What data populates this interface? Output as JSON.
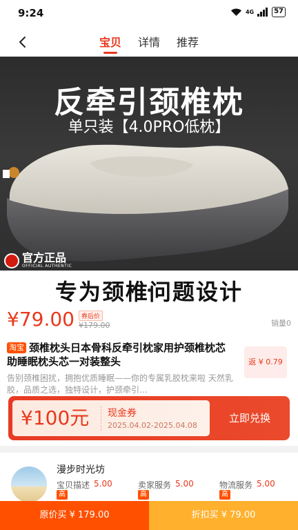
{
  "status_bar": {
    "time": "9:24",
    "network": "4G",
    "battery": "57"
  },
  "nav": {
    "tabs": [
      {
        "label": "宝贝",
        "active": true
      },
      {
        "label": "详情",
        "active": false
      },
      {
        "label": "推荐",
        "active": false
      }
    ]
  },
  "hero": {
    "headline": "反牵引颈椎枕",
    "subline": "单只装【4.0PRO低枕】",
    "official_badge": "官方正品",
    "official_badge_en": "OFFICIAL AUTHENTIC",
    "banner": "专为颈椎问题设计"
  },
  "price": {
    "current": "¥79.00",
    "after_coupon_tag": "券后价",
    "original": "¥179.00",
    "sales": "销量0"
  },
  "product": {
    "platform_tag": "淘宝",
    "title": "颈椎枕头日本骨科反牵引枕家用护颈椎枕芯助睡眠枕头芯一对装整头",
    "description": "告别颈椎困扰，拥抱优质睡眠——你的专属乳胶枕来啦 天然乳胶，品质之选，独特设计，护颈牵引...",
    "rebate": "返 ¥ 0.79"
  },
  "coupon": {
    "amount": "¥100元",
    "title": "现金券",
    "dates": "2025.04.02-2025.04.08",
    "button": "立即兑换"
  },
  "shop": {
    "name": "漫步时光坊",
    "ratings": [
      {
        "label": "宝贝描述",
        "value": "5.00",
        "level": "高"
      },
      {
        "label": "卖家服务",
        "value": "5.00",
        "level": "高"
      },
      {
        "label": "物流服务",
        "value": "5.00",
        "level": "高"
      }
    ]
  },
  "bottom_bar": {
    "original_buy": "原价买 ¥ 179.00",
    "discount_buy": "折扣买 ¥ 79.00"
  },
  "colors": {
    "accent": "#e8381c",
    "orange": "#ff5000",
    "yellow": "#ffb02d"
  }
}
